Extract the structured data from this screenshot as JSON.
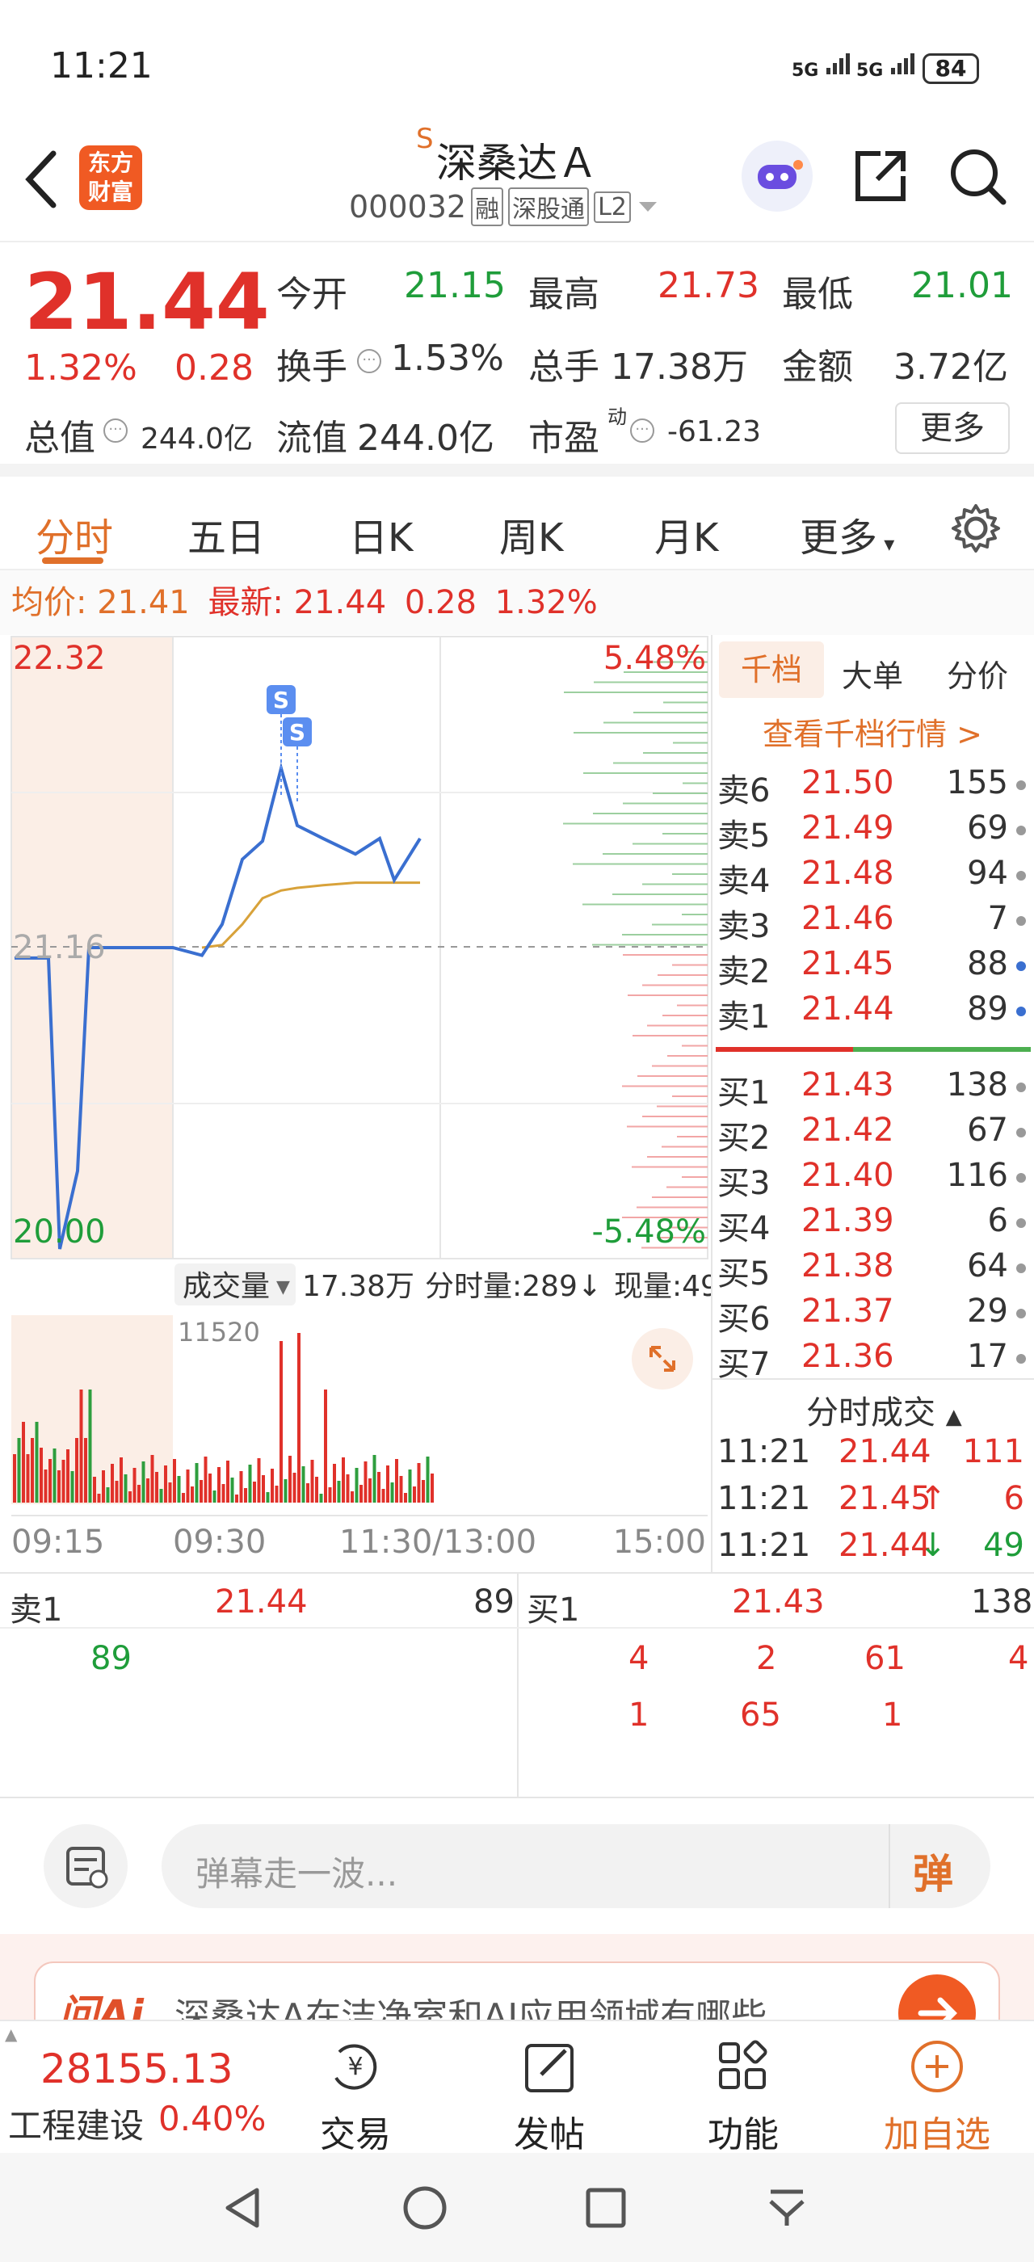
{
  "status": {
    "time": "11:21",
    "signal1": "5G",
    "signal2": "5G",
    "battery": "84"
  },
  "header": {
    "brand_logo_text": "东方财富",
    "st_mark": "S",
    "stock_name": "深桑达Ａ",
    "stock_code": "000032",
    "tag_margin": "融",
    "tag_connect": "深股通",
    "tag_level": "L2"
  },
  "quote": {
    "price": "21.44",
    "change_pct": "1.32%",
    "change": "0.28",
    "open_label": "今开",
    "open": "21.15",
    "high_label": "最高",
    "high": "21.73",
    "low_label": "最低",
    "low": "21.01",
    "turnover_label": "换手",
    "turnover": "1.53%",
    "volume_label": "总手",
    "volume": "17.38万",
    "amount_label": "金额",
    "amount": "3.72亿",
    "mktcap_label": "总值",
    "mktcap": "244.0亿",
    "float_label": "流值",
    "float_cap": "244.0亿",
    "pe_label": "市盈",
    "pe_sup": "动",
    "pe": "-61.23",
    "more_button": "更多"
  },
  "tabs": [
    "分时",
    "五日",
    "日K",
    "周K",
    "月K",
    "更多"
  ],
  "avg_line": {
    "avg_label": "均价:",
    "avg_value": "21.41",
    "latest_label": "最新:",
    "latest_value": "21.44",
    "latest_change": "0.28",
    "latest_pct": "1.32%"
  },
  "chart": {
    "y_top": "22.32",
    "y_mid": "21.16",
    "y_bottom": "20.00",
    "pct_top": "5.48%",
    "pct_bottom": "-5.48%",
    "sell_marker": "S",
    "volume_label": "成交量",
    "volume_total": "17.38万",
    "minute_vol_label": "分时量:289↓",
    "current_vol": "现量:49",
    "vol_max": "11520",
    "x_labels": [
      "09:15",
      "09:30",
      "11:30/13:00",
      "15:00"
    ]
  },
  "chart_data": {
    "type": "line",
    "ylim": [
      20.0,
      22.32
    ],
    "series": [
      {
        "name": "价格",
        "values": [
          21.12,
          21.12,
          20.0,
          20.3,
          21.16,
          21.16,
          21.16,
          21.13,
          21.25,
          21.5,
          21.57,
          21.85,
          21.63,
          21.58,
          21.52,
          21.58,
          21.42,
          21.58
        ]
      },
      {
        "name": "均价",
        "values": [
          null,
          null,
          null,
          null,
          null,
          null,
          null,
          21.16,
          21.17,
          21.25,
          21.35,
          21.38,
          21.39,
          21.4,
          21.41,
          21.41,
          21.41,
          21.41
        ]
      }
    ],
    "xlabel": "",
    "ylabel": ""
  },
  "orderbook": {
    "tabs": [
      "千档",
      "大单",
      "分价"
    ],
    "link": "查看千档行情 >",
    "sells": [
      {
        "label": "卖6",
        "price": "21.50",
        "vol": "155"
      },
      {
        "label": "卖5",
        "price": "21.49",
        "vol": "69"
      },
      {
        "label": "卖4",
        "price": "21.48",
        "vol": "94"
      },
      {
        "label": "卖3",
        "price": "21.46",
        "vol": "7"
      },
      {
        "label": "卖2",
        "price": "21.45",
        "vol": "88"
      },
      {
        "label": "卖1",
        "price": "21.44",
        "vol": "89"
      }
    ],
    "buys": [
      {
        "label": "买1",
        "price": "21.43",
        "vol": "138"
      },
      {
        "label": "买2",
        "price": "21.42",
        "vol": "67"
      },
      {
        "label": "买3",
        "price": "21.40",
        "vol": "116"
      },
      {
        "label": "买4",
        "price": "21.39",
        "vol": "6"
      },
      {
        "label": "买5",
        "price": "21.38",
        "vol": "64"
      },
      {
        "label": "买6",
        "price": "21.37",
        "vol": "29"
      },
      {
        "label": "买7",
        "price": "21.36",
        "vol": "17"
      }
    ],
    "trades_title": "分时成交",
    "trades": [
      {
        "time": "11:21",
        "price": "21.44",
        "arrow": "",
        "vol": "111"
      },
      {
        "time": "11:21",
        "price": "21.45",
        "arrow": "↑",
        "vol": "6"
      },
      {
        "time": "11:21",
        "price": "21.44",
        "arrow": "↓",
        "vol": "49"
      }
    ]
  },
  "queue": {
    "sell_label": "卖1",
    "sell_price": "21.44",
    "sell_vol": "89",
    "buy_label": "买1",
    "buy_price": "21.43",
    "buy_vol": "138",
    "sell_items": [
      "89"
    ],
    "buy_row1": [
      "4",
      "2",
      "61",
      "4"
    ],
    "buy_row2": [
      "1",
      "65",
      "1"
    ]
  },
  "danmu": {
    "placeholder": "弹幕走一波...",
    "send": "弹"
  },
  "ai_banner": {
    "brand": "问Ai",
    "text": "深桑达A在洁净室和AI应用领域有哪些"
  },
  "bottom_nav": {
    "index_value": "28155.13",
    "index_name": "工程建设",
    "index_pct": "0.40%",
    "items": [
      "交易",
      "发帖",
      "功能",
      "加自选"
    ]
  }
}
